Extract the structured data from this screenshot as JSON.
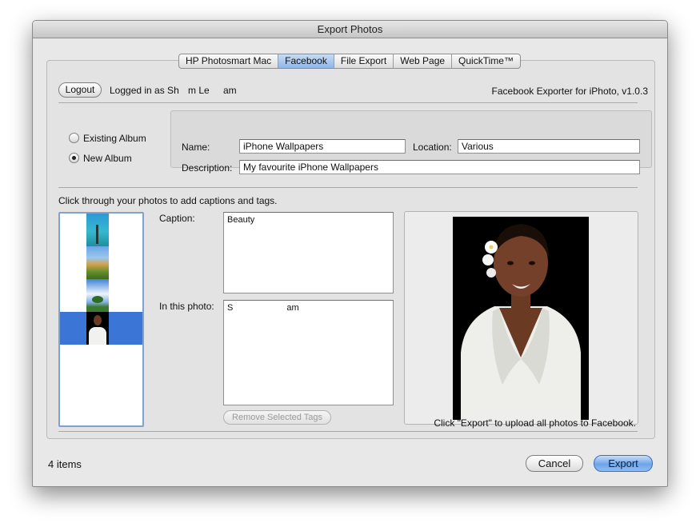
{
  "window": {
    "title": "Export Photos"
  },
  "tabs": [
    {
      "label": "HP Photosmart Mac",
      "selected": false
    },
    {
      "label": "Facebook",
      "selected": true
    },
    {
      "label": "File Export",
      "selected": false
    },
    {
      "label": "Web Page",
      "selected": false
    },
    {
      "label": "QuickTime™",
      "selected": false
    }
  ],
  "account": {
    "logout_label": "Logout",
    "logged_in_prefix": "Logged in as Sh",
    "logged_in_mid": "m Le",
    "logged_in_end": "am",
    "exporter_version": "Facebook Exporter for iPhoto, v1.0.3"
  },
  "album": {
    "existing_label": "Existing Album",
    "new_label": "New Album",
    "selected": "new",
    "name_label": "Name:",
    "name_value": "iPhone Wallpapers",
    "location_label": "Location:",
    "location_value": "Various",
    "description_label": "Description:",
    "description_value": "My favourite iPhone Wallpapers"
  },
  "photos": {
    "instructions": "Click through your photos to add captions and tags.",
    "caption_label": "Caption:",
    "caption_value": "Beauty",
    "in_photo_label": "In this photo:",
    "tag_start": "S",
    "tag_end": "am",
    "remove_tags_label": "Remove Selected Tags",
    "thumbnails": [
      "beach-pier",
      "hill-field",
      "tree-sky",
      "woman-portrait"
    ],
    "selected_index": 3
  },
  "footer": {
    "export_hint": "Click \"Export\" to upload all photos to Facebook.",
    "item_count": "4 items",
    "cancel_label": "Cancel",
    "export_label": "Export"
  },
  "colors": {
    "accent": "#3b75d6",
    "selected_tab": "#9cc0ec",
    "export_button": "#6ea5ea"
  }
}
